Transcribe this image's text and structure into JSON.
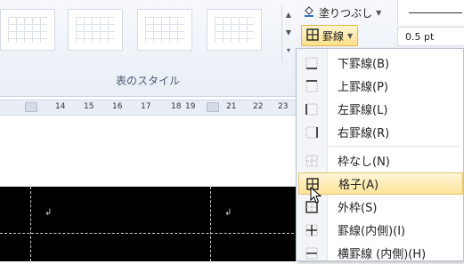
{
  "ribbon": {
    "group_label": "表のスタイル",
    "shading_label": "塗りつぶし",
    "border_label": "罫線",
    "pen_weight": "0.5 pt"
  },
  "ruler": {
    "ticks": [
      "14",
      "15",
      "16",
      "17",
      "18",
      "19",
      "21",
      "22",
      "23"
    ]
  },
  "menu": {
    "items": [
      {
        "label": "下罫線(B)",
        "icon": "border-bottom-icon"
      },
      {
        "label": "上罫線(P)",
        "icon": "border-top-icon"
      },
      {
        "label": "左罫線(L)",
        "icon": "border-left-icon"
      },
      {
        "label": "右罫線(R)",
        "icon": "border-right-icon"
      },
      {
        "label": "枠なし(N)",
        "icon": "no-border-icon"
      },
      {
        "label": "格子(A)",
        "icon": "all-borders-icon"
      },
      {
        "label": "外枠(S)",
        "icon": "outside-border-icon"
      },
      {
        "label": "罫線(内側)(I)",
        "icon": "inside-border-icon"
      },
      {
        "label": "横罫線 (内側)(H)",
        "icon": "inside-horizontal-border-icon"
      }
    ]
  },
  "colors": {
    "highlight": "#ffe59a",
    "table_bg": "#000000"
  }
}
